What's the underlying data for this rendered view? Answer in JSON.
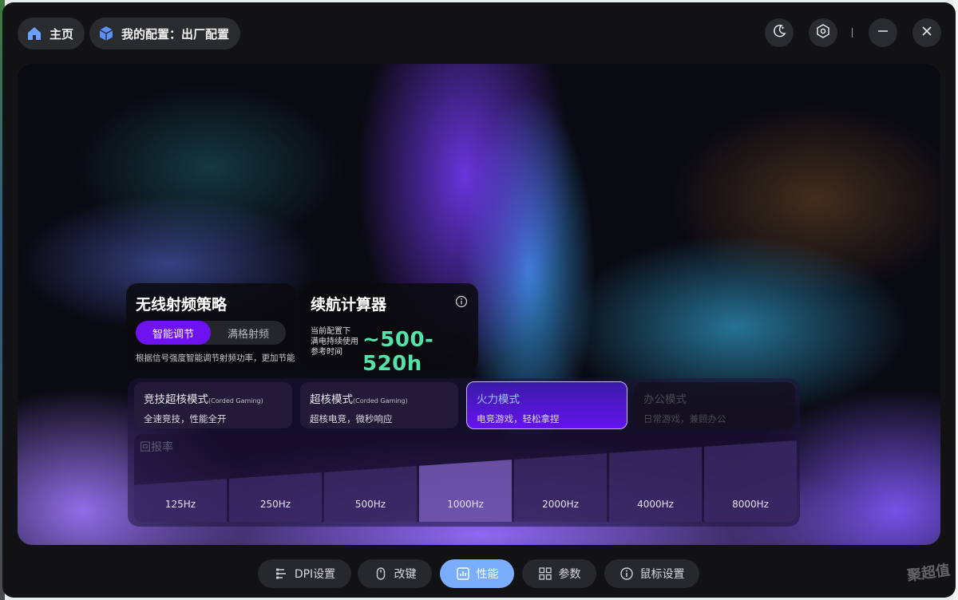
{
  "header": {
    "home_label": "主页",
    "profile_label": "我的配置：出厂配置"
  },
  "window_controls": {
    "theme_icon": "moon-icon",
    "settings_icon": "settings-hex-icon",
    "minimize_icon": "minimize-icon",
    "close_icon": "close-icon"
  },
  "rf_card": {
    "title": "无线射频策略",
    "options": [
      "智能调节",
      "满格射频"
    ],
    "selected": "智能调节",
    "description": "根据信号强度智能调节射频功率，更加节能"
  },
  "battery_card": {
    "title": "续航计算器",
    "lines": [
      "当前配置下",
      "满电持续使用",
      "参考时间"
    ],
    "runtime": "~500-520h",
    "runtime_color": "#54e3a6"
  },
  "modes": [
    {
      "title": "竞技超核模式",
      "tag": "(Corded Gaming)",
      "desc": "全速竞技，性能全开",
      "state": "normal"
    },
    {
      "title": "超核模式",
      "tag": "(Corded Gaming)",
      "desc": "超核电竞，微秒响应",
      "state": "normal"
    },
    {
      "title": "火力模式",
      "tag": "",
      "desc": "电竞游戏，轻松拿捏",
      "state": "active"
    },
    {
      "title": "办公模式",
      "tag": "",
      "desc": "日常游戏，兼顾办公",
      "state": "disabled"
    }
  ],
  "polling_rate": {
    "title": "回报率",
    "options": [
      "125Hz",
      "250Hz",
      "500Hz",
      "1000Hz",
      "2000Hz",
      "4000Hz",
      "8000Hz"
    ],
    "selected": "1000Hz"
  },
  "bottom_nav": {
    "items": [
      {
        "label": "DPI设置",
        "icon": "dpi-sliders-icon"
      },
      {
        "label": "改键",
        "icon": "mouse-icon"
      },
      {
        "label": "性能",
        "icon": "performance-chart-icon"
      },
      {
        "label": "参数",
        "icon": "grid-icon"
      },
      {
        "label": "鼠标设置",
        "icon": "info-icon"
      }
    ],
    "active": "性能"
  },
  "watermark": "聚超值",
  "colors": {
    "accent_purple": "#6f12f0",
    "active_nav": "#7aaefd"
  }
}
